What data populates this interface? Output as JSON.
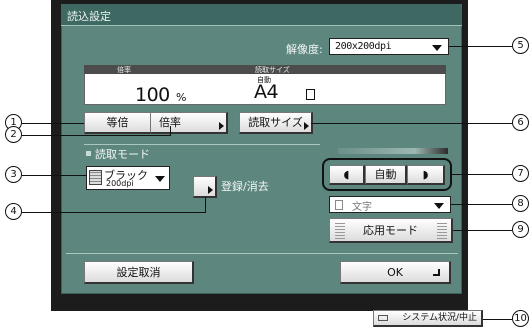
{
  "window": {
    "title": "読込設定"
  },
  "resolution": {
    "label": "解像度:",
    "value": "200x200dpi"
  },
  "display": {
    "ratio_header": "倍率",
    "ratio_value": "100",
    "ratio_unit": "%",
    "size_header": "読取サイズ",
    "size_mode": "自動",
    "size_value": "A4"
  },
  "buttons": {
    "equal": "等倍",
    "ratio": "倍率",
    "read_size": "読取サイズ",
    "register": "登録/消去",
    "cancel": "設定取消",
    "ok": "OK",
    "app_mode": "応用モード"
  },
  "read_mode": {
    "title": "読取モード",
    "value_line1": "ブラック",
    "value_line2": "200dpi"
  },
  "exposure": {
    "mode": "自動"
  },
  "doc_type": {
    "value": "文字"
  },
  "status_button": "システム状況/中止",
  "callouts": [
    "1",
    "2",
    "3",
    "4",
    "5",
    "6",
    "7",
    "8",
    "9",
    "10"
  ]
}
